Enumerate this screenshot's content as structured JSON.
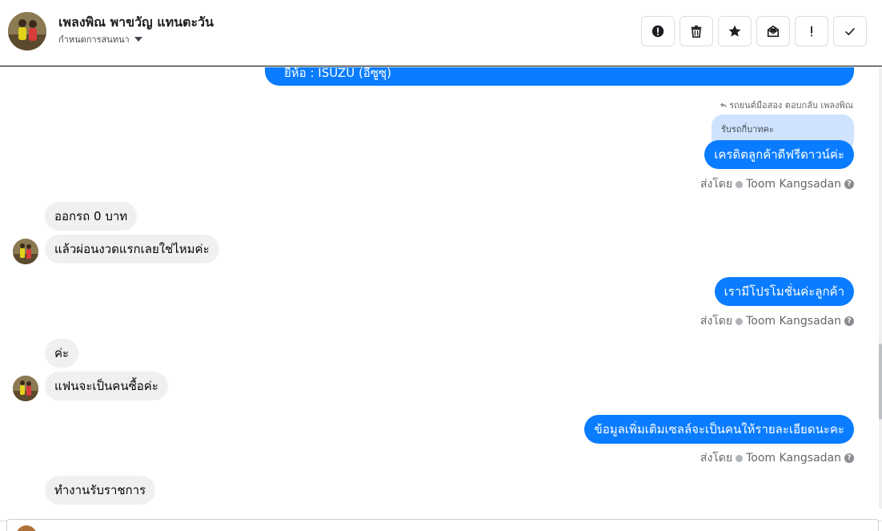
{
  "header": {
    "contact_name": "เพลงพิณ พาขวัญ แทนตะวัน",
    "assign_label": "กำหนดการสนทนา",
    "actions": [
      {
        "icon": "alert-circle-icon"
      },
      {
        "icon": "trash-icon"
      },
      {
        "icon": "star-icon"
      },
      {
        "icon": "archive-icon"
      },
      {
        "icon": "exclamation-icon"
      },
      {
        "icon": "check-icon"
      }
    ]
  },
  "conversation": {
    "top_partial_message": "ยี่ห้อ : ISUZU (อีซูซุ)",
    "reply_context": "รถยนต์มือสอง ตอบกลับ เพลงพิณ",
    "quoted_message": "รับรถกี่บาทคะ",
    "messages": [
      {
        "direction": "out",
        "text": "เครดิตลูกค้าดีฟรีดาวน์ค่ะ",
        "sender_prefix": "ส่งโดย",
        "sender": "Toom Kangsadan"
      },
      {
        "direction": "in",
        "text": "ออกรถ 0 บาท"
      },
      {
        "direction": "in",
        "text": "แล้วผ่อนงวดแรกเลยใช่ไหมค่ะ"
      },
      {
        "direction": "out",
        "text": "เรามีโปรโมชั่นค่ะลูกค้า",
        "sender_prefix": "ส่งโดย",
        "sender": "Toom Kangsadan"
      },
      {
        "direction": "in",
        "text": "ค่ะ"
      },
      {
        "direction": "in",
        "text": "แฟนจะเป็นคนซื้อค่ะ"
      },
      {
        "direction": "out",
        "text": "ข้อมูลเพิ่มเติมเซลล์จะเป็นคนให้รายละเอียดนะคะ",
        "sender_prefix": "ส่งโดย",
        "sender": "Toom Kangsadan"
      },
      {
        "direction": "in",
        "text": "ทำงานรับราชการ"
      }
    ]
  },
  "colors": {
    "outgoing_bubble": "#0a7cff",
    "incoming_bubble": "#f0f0f0",
    "quoted_bubble": "#cfe3ff"
  }
}
